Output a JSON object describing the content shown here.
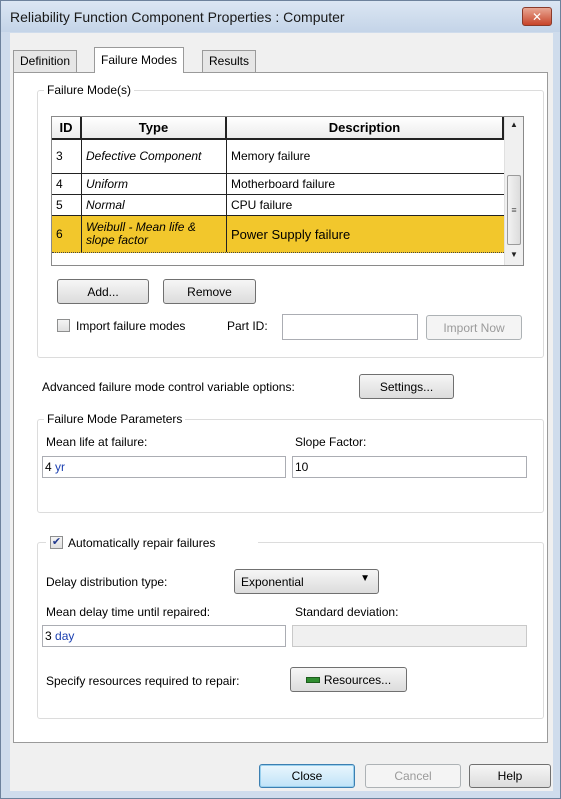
{
  "window": {
    "title": "Reliability Function Component Properties : Computer",
    "close_glyph": "✕"
  },
  "tabs": [
    {
      "label": "Definition"
    },
    {
      "label": "Failure Modes",
      "active": true
    },
    {
      "label": "Results"
    }
  ],
  "failure_modes": {
    "group_title": "Failure Mode(s)",
    "columns": [
      "ID",
      "Type",
      "Description"
    ],
    "rows": [
      {
        "id": "3",
        "type": "Defective Component",
        "description": "Memory failure"
      },
      {
        "id": "4",
        "type": "Uniform",
        "description": "Motherboard failure"
      },
      {
        "id": "5",
        "type": "Normal",
        "description": "CPU failure"
      },
      {
        "id": "6",
        "type": "Weibull - Mean life & slope factor",
        "description": "Power Supply failure",
        "selected": true
      }
    ],
    "add_label": "Add...",
    "remove_label": "Remove",
    "import_checkbox_label": "Import failure modes",
    "import_checked": false,
    "part_id_label": "Part ID:",
    "part_id_value": "",
    "import_now_label": "Import Now"
  },
  "advanced": {
    "label": "Advanced failure mode control variable options:",
    "settings_label": "Settings..."
  },
  "parameters": {
    "group_title": "Failure Mode Parameters",
    "mean_life_label": "Mean life at failure:",
    "mean_life_value": "4",
    "mean_life_unit": "yr",
    "slope_label": "Slope Factor:",
    "slope_value": "10"
  },
  "repair": {
    "checkbox_label": "Automatically repair failures",
    "checked": true,
    "delay_type_label": "Delay distribution type:",
    "delay_type_value": "Exponential",
    "mean_delay_label": "Mean delay time until repaired:",
    "mean_delay_value": "3",
    "mean_delay_unit": "day",
    "std_dev_label": "Standard deviation:",
    "std_dev_value": "",
    "resources_label": "Specify resources required to repair:",
    "resources_button": "Resources..."
  },
  "footer": {
    "close_label": "Close",
    "cancel_label": "Cancel",
    "help_label": "Help"
  }
}
